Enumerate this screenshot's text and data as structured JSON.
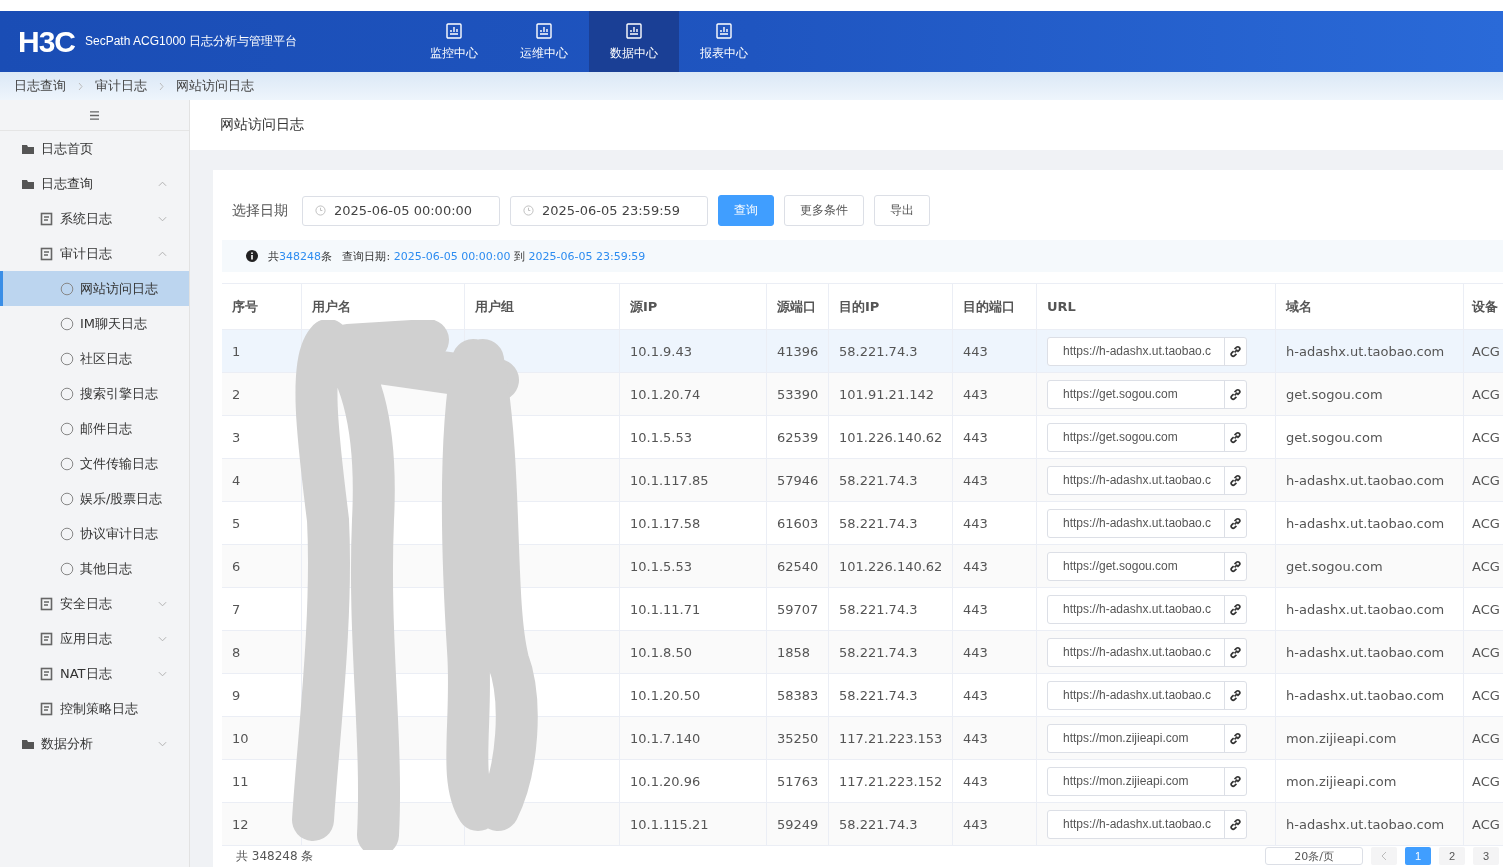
{
  "header": {
    "logo": "H3C",
    "product": "SecPath ACG1000 日志分析与管理平台",
    "nav": [
      {
        "label": "监控中心",
        "selected": false
      },
      {
        "label": "运维中心",
        "selected": false
      },
      {
        "label": "数据中心",
        "selected": true
      },
      {
        "label": "报表中心",
        "selected": false
      }
    ]
  },
  "breadcrumb": [
    "日志查询",
    "审计日志",
    "网站访问日志"
  ],
  "sidebar": {
    "items": [
      {
        "label": "日志首页"
      },
      {
        "label": "日志查询",
        "expanded": true,
        "children": [
          {
            "label": "系统日志",
            "expanded": false
          },
          {
            "label": "审计日志",
            "expanded": true,
            "children": [
              {
                "label": "网站访问日志",
                "selected": true
              },
              {
                "label": "IM聊天日志",
                "selected": false
              },
              {
                "label": "社区日志",
                "selected": false
              },
              {
                "label": "搜索引擎日志",
                "selected": false
              },
              {
                "label": "邮件日志",
                "selected": false
              },
              {
                "label": "文件传输日志",
                "selected": false
              },
              {
                "label": "娱乐/股票日志",
                "selected": false
              },
              {
                "label": "协议审计日志",
                "selected": false
              },
              {
                "label": "其他日志",
                "selected": false
              }
            ]
          },
          {
            "label": "安全日志",
            "expanded": false
          },
          {
            "label": "应用日志",
            "expanded": false
          },
          {
            "label": "NAT日志",
            "expanded": false
          },
          {
            "label": "控制策略日志"
          }
        ]
      },
      {
        "label": "数据分析",
        "expanded": false
      }
    ]
  },
  "page_title": "网站访问日志",
  "filter": {
    "label": "选择日期",
    "start": "2025-06-05 00:00:00",
    "end": "2025-06-05 23:59:59",
    "buttons": [
      {
        "label": "查询",
        "kind": "primary"
      },
      {
        "label": "更多条件",
        "kind": "default"
      },
      {
        "label": "导出",
        "kind": "default"
      }
    ]
  },
  "summary": {
    "prefix": "共",
    "count": "348248",
    "suffix": "条",
    "date_label": "查询日期:",
    "start": "2025-06-05 00:00:00",
    "to": "到",
    "end": "2025-06-05 23:59:59"
  },
  "table": {
    "columns": [
      "序号",
      "用户名",
      "用户组",
      "源IP",
      "源端口",
      "目的IP",
      "目的端口",
      "URL",
      "域名",
      "设备"
    ],
    "rows": [
      {
        "selected": true,
        "cells": [
          "1",
          "",
          "",
          "10.1.9.43",
          "41396",
          "58.221.74.3",
          "443",
          "https://h-adashx.ut.taobao.c",
          "h-adashx.ut.taobao.com",
          "ACG"
        ]
      },
      {
        "selected": false,
        "cells": [
          "2",
          "",
          "",
          "10.1.20.74",
          "53390",
          "101.91.21.142",
          "443",
          "https://get.sogou.com",
          "get.sogou.com",
          "ACG"
        ]
      },
      {
        "selected": false,
        "cells": [
          "3",
          "",
          "",
          "10.1.5.53",
          "62539",
          "101.226.140.62",
          "443",
          "https://get.sogou.com",
          "get.sogou.com",
          "ACG"
        ]
      },
      {
        "selected": false,
        "cells": [
          "4",
          "",
          "",
          "10.1.117.85",
          "57946",
          "58.221.74.3",
          "443",
          "https://h-adashx.ut.taobao.c",
          "h-adashx.ut.taobao.com",
          "ACG"
        ]
      },
      {
        "selected": false,
        "cells": [
          "5",
          "",
          "",
          "10.1.17.58",
          "61603",
          "58.221.74.3",
          "443",
          "https://h-adashx.ut.taobao.c",
          "h-adashx.ut.taobao.com",
          "ACG"
        ]
      },
      {
        "selected": false,
        "cells": [
          "6",
          "",
          "",
          "10.1.5.53",
          "62540",
          "101.226.140.62",
          "443",
          "https://get.sogou.com",
          "get.sogou.com",
          "ACG"
        ]
      },
      {
        "selected": false,
        "cells": [
          "7",
          "",
          "",
          "10.1.11.71",
          "59707",
          "58.221.74.3",
          "443",
          "https://h-adashx.ut.taobao.c",
          "h-adashx.ut.taobao.com",
          "ACG"
        ]
      },
      {
        "selected": false,
        "cells": [
          "8",
          "",
          "",
          "10.1.8.50",
          "1858",
          "58.221.74.3",
          "443",
          "https://h-adashx.ut.taobao.c",
          "h-adashx.ut.taobao.com",
          "ACG"
        ]
      },
      {
        "selected": false,
        "cells": [
          "9",
          "",
          "",
          "10.1.20.50",
          "58383",
          "58.221.74.3",
          "443",
          "https://h-adashx.ut.taobao.c",
          "h-adashx.ut.taobao.com",
          "ACG"
        ]
      },
      {
        "selected": false,
        "cells": [
          "10",
          "",
          "",
          "10.1.7.140",
          "35250",
          "117.21.223.153",
          "443",
          "https://mon.zijieapi.com",
          "mon.zijieapi.com",
          "ACG"
        ]
      },
      {
        "selected": false,
        "cells": [
          "11",
          "",
          "",
          "10.1.20.96",
          "51763",
          "117.21.223.152",
          "443",
          "https://mon.zijieapi.com",
          "mon.zijieapi.com",
          "ACG"
        ]
      },
      {
        "selected": false,
        "cells": [
          "12",
          "",
          "",
          "10.1.115.21",
          "59249",
          "58.221.74.3",
          "443",
          "https://h-adashx.ut.taobao.c",
          "h-adashx.ut.taobao.com",
          "ACG"
        ]
      }
    ]
  },
  "pagination": {
    "total": "共 348248 条",
    "page_size": "20条/页",
    "pages": [
      {
        "label": "1",
        "selected": true
      },
      {
        "label": "2",
        "selected": false
      },
      {
        "label": "3",
        "selected": false
      }
    ]
  }
}
